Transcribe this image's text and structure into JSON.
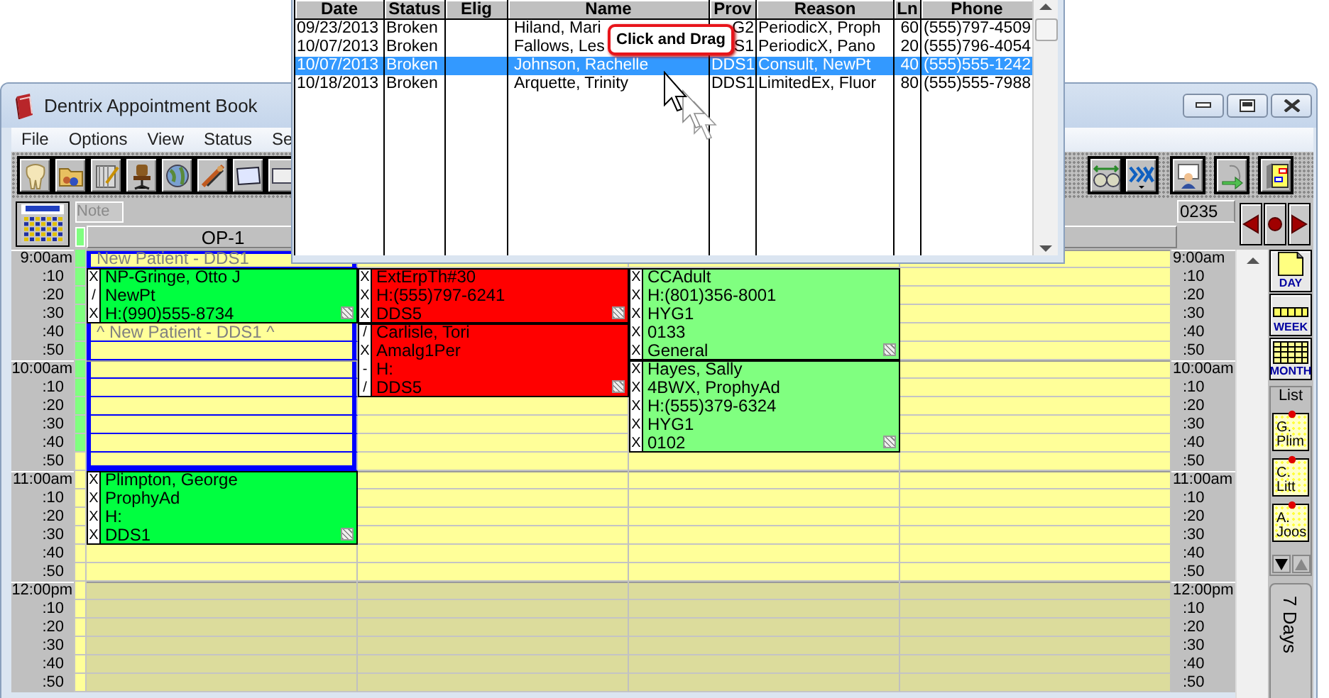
{
  "window": {
    "title": "Dentrix Appointment Book"
  },
  "menu": [
    "File",
    "Options",
    "View",
    "Status",
    "Se"
  ],
  "note": {
    "placeholder": "Note"
  },
  "counter": "0235",
  "slots": [
    {
      "left": "9:00am",
      "right": "9:00am",
      "kind": "hour",
      "shaded": false,
      "marked": true
    },
    {
      "left": ":10",
      "right": ":10",
      "kind": "minute",
      "shaded": false,
      "marked": true
    },
    {
      "left": ":20",
      "right": ":20",
      "kind": "minute",
      "shaded": false,
      "marked": true
    },
    {
      "left": ":30",
      "right": ":30",
      "kind": "minute",
      "shaded": false,
      "marked": true
    },
    {
      "left": ":40",
      "right": ":40",
      "kind": "minute",
      "shaded": false,
      "marked": true
    },
    {
      "left": ":50",
      "right": ":50",
      "kind": "minute",
      "shaded": false,
      "marked": true
    },
    {
      "left": "10:00am",
      "right": "10:00am",
      "kind": "hour",
      "shaded": false,
      "marked": true
    },
    {
      "left": ":10",
      "right": ":10",
      "kind": "minute",
      "shaded": false,
      "marked": true
    },
    {
      "left": ":20",
      "right": ":20",
      "kind": "minute",
      "shaded": false,
      "marked": true
    },
    {
      "left": ":30",
      "right": ":30",
      "kind": "minute",
      "shaded": false,
      "marked": true
    },
    {
      "left": ":40",
      "right": ":40",
      "kind": "minute",
      "shaded": false,
      "marked": true
    },
    {
      "left": ":50",
      "right": ":50",
      "kind": "minute",
      "shaded": false,
      "marked": false
    },
    {
      "left": "11:00am",
      "right": "11:00am",
      "kind": "hour",
      "shaded": false,
      "marked": false
    },
    {
      "left": ":10",
      "right": ":10",
      "kind": "minute",
      "shaded": false,
      "marked": false
    },
    {
      "left": ":20",
      "right": ":20",
      "kind": "minute",
      "shaded": false,
      "marked": false
    },
    {
      "left": ":30",
      "right": ":30",
      "kind": "minute",
      "shaded": false,
      "marked": false
    },
    {
      "left": ":40",
      "right": ":40",
      "kind": "minute",
      "shaded": false,
      "marked": false
    },
    {
      "left": ":50",
      "right": ":50",
      "kind": "minute",
      "shaded": false,
      "marked": false
    },
    {
      "left": "12:00pm",
      "right": "12:00pm",
      "kind": "hour",
      "shaded": true,
      "marked": false
    },
    {
      "left": ":10",
      "right": ":10",
      "kind": "minute",
      "shaded": true,
      "marked": false
    },
    {
      "left": ":20",
      "right": ":20",
      "kind": "minute",
      "shaded": true,
      "marked": false
    },
    {
      "left": ":30",
      "right": ":30",
      "kind": "minute",
      "shaded": true,
      "marked": false
    },
    {
      "left": ":40",
      "right": ":40",
      "kind": "minute",
      "shaded": true,
      "marked": false
    },
    {
      "left": ":50",
      "right": ":50",
      "kind": "minute",
      "shaded": true,
      "marked": false
    }
  ],
  "columns": [
    {
      "header": "OP-1",
      "entries": [
        {
          "kind": "slot",
          "reserved": true,
          "label": "New Patient - DDS1"
        },
        {
          "kind": "appointment",
          "color": "#00ff40",
          "lines": [
            {
              "mark": "X",
              "text": "NP-Gringe, Otto J"
            },
            {
              "mark": "/",
              "text": "NewPt"
            },
            {
              "mark": "X",
              "text": "H:(990)555-8734"
            }
          ]
        },
        {
          "kind": "slot",
          "reserved": true,
          "label": "^ New Patient - DDS1 ^"
        },
        {
          "kind": "slot",
          "reserved": true
        },
        {
          "kind": "slot",
          "reserved": true
        },
        {
          "kind": "slot",
          "reserved": true
        },
        {
          "kind": "slot",
          "reserved": true
        },
        {
          "kind": "slot",
          "reserved": true
        },
        {
          "kind": "slot",
          "reserved": true
        },
        {
          "kind": "slot",
          "reserved": true
        },
        {
          "kind": "appointment",
          "color": "#00ff40",
          "lines": [
            {
              "mark": "X",
              "text": "Plimpton, George"
            },
            {
              "mark": "X",
              "text": "ProphyAd"
            },
            {
              "mark": "X",
              "text": "H:"
            },
            {
              "mark": "X",
              "text": "DDS1"
            }
          ]
        },
        {
          "kind": "slot",
          "reserved": false
        },
        {
          "kind": "slot",
          "reserved": false
        },
        {
          "kind": "slot",
          "reserved": false
        },
        {
          "kind": "slot",
          "reserved": false
        },
        {
          "kind": "slot",
          "reserved": false
        },
        {
          "kind": "slot",
          "reserved": false
        },
        {
          "kind": "slot",
          "reserved": false
        },
        {
          "kind": "slot",
          "reserved": false
        }
      ]
    },
    {
      "entries": [
        {
          "kind": "slot",
          "reserved": false
        },
        {
          "kind": "appointment",
          "color": "#ff0000",
          "lines": [
            {
              "mark": "X",
              "text": "ExtErpTh#30"
            },
            {
              "mark": "X",
              "text": "H:(555)797-6241"
            },
            {
              "mark": "X",
              "text": "DDS5"
            }
          ]
        },
        {
          "kind": "appointment",
          "color": "#ff0000",
          "lines": [
            {
              "mark": "/",
              "text": "Carlisle, Tori"
            },
            {
              "mark": "X",
              "text": "Amalg1Per"
            },
            {
              "mark": "-",
              "text": "H:"
            },
            {
              "mark": "/",
              "text": "DDS5"
            }
          ]
        },
        {
          "kind": "slot",
          "reserved": false
        },
        {
          "kind": "slot",
          "reserved": false
        },
        {
          "kind": "slot",
          "reserved": false
        },
        {
          "kind": "slot",
          "reserved": false
        },
        {
          "kind": "slot",
          "reserved": false
        },
        {
          "kind": "slot",
          "reserved": false
        },
        {
          "kind": "slot",
          "reserved": false
        },
        {
          "kind": "slot",
          "reserved": false
        },
        {
          "kind": "slot",
          "reserved": false
        },
        {
          "kind": "slot",
          "reserved": false
        },
        {
          "kind": "slot",
          "reserved": false
        },
        {
          "kind": "slot",
          "reserved": false
        },
        {
          "kind": "slot",
          "reserved": false
        },
        {
          "kind": "slot",
          "reserved": false
        },
        {
          "kind": "slot",
          "reserved": false
        },
        {
          "kind": "slot",
          "reserved": false
        }
      ]
    },
    {
      "entries": [
        {
          "kind": "slot",
          "reserved": false
        },
        {
          "kind": "appointment",
          "color": "#80ff80",
          "lines": [
            {
              "mark": "X",
              "text": "CCAdult"
            },
            {
              "mark": "X",
              "text": "H:(801)356-8001"
            },
            {
              "mark": "X",
              "text": "HYG1"
            },
            {
              "mark": "X",
              "text": "0133"
            },
            {
              "mark": "X",
              "text": "General"
            }
          ]
        },
        {
          "kind": "appointment",
          "color": "#80ff80",
          "lines": [
            {
              "mark": "X",
              "text": "Hayes, Sally"
            },
            {
              "mark": "X",
              "text": "4BWX, ProphyAd"
            },
            {
              "mark": "X",
              "text": "H:(555)379-6324"
            },
            {
              "mark": "X",
              "text": "HYG1"
            },
            {
              "mark": "X",
              "text": "0102"
            }
          ]
        },
        {
          "kind": "slot",
          "reserved": false
        },
        {
          "kind": "slot",
          "reserved": false
        },
        {
          "kind": "slot",
          "reserved": false
        },
        {
          "kind": "slot",
          "reserved": false
        },
        {
          "kind": "slot",
          "reserved": false
        },
        {
          "kind": "slot",
          "reserved": false
        },
        {
          "kind": "slot",
          "reserved": false
        },
        {
          "kind": "slot",
          "reserved": false
        },
        {
          "kind": "slot",
          "reserved": false
        },
        {
          "kind": "slot",
          "reserved": false
        },
        {
          "kind": "slot",
          "reserved": false
        },
        {
          "kind": "slot",
          "reserved": false
        },
        {
          "kind": "slot",
          "reserved": false
        }
      ]
    },
    {
      "entries": [
        {
          "kind": "slot",
          "reserved": false
        },
        {
          "kind": "slot",
          "reserved": false
        },
        {
          "kind": "slot",
          "reserved": false
        },
        {
          "kind": "slot",
          "reserved": false
        },
        {
          "kind": "slot",
          "reserved": false
        },
        {
          "kind": "slot",
          "reserved": false
        },
        {
          "kind": "slot",
          "reserved": false
        },
        {
          "kind": "slot",
          "reserved": false
        },
        {
          "kind": "slot",
          "reserved": false
        },
        {
          "kind": "slot",
          "reserved": false
        },
        {
          "kind": "slot",
          "reserved": false
        },
        {
          "kind": "slot",
          "reserved": false
        },
        {
          "kind": "slot",
          "reserved": false
        },
        {
          "kind": "slot",
          "reserved": false
        },
        {
          "kind": "slot",
          "reserved": false
        },
        {
          "kind": "slot",
          "reserved": false
        },
        {
          "kind": "slot",
          "reserved": false
        },
        {
          "kind": "slot",
          "reserved": false
        },
        {
          "kind": "slot",
          "reserved": false
        },
        {
          "kind": "slot",
          "reserved": false
        },
        {
          "kind": "slot",
          "reserved": false
        },
        {
          "kind": "slot",
          "reserved": false
        },
        {
          "kind": "slot",
          "reserved": false
        },
        {
          "kind": "slot",
          "reserved": false
        }
      ]
    }
  ],
  "view_buttons": [
    "DAY",
    "WEEK",
    "MONTH"
  ],
  "list_panel": {
    "title": "List",
    "notes": [
      "G. Plim",
      "C. Litt",
      "A. Joos"
    ]
  },
  "side_tab": "7 Days",
  "appointment_list": {
    "columns": [
      "Date",
      "Status",
      "Elig",
      "Name",
      "Prov",
      "Reason",
      "Ln",
      "Phone"
    ],
    "rows": [
      {
        "cells": [
          "09/23/2013",
          "Broken",
          "",
          "Hiland, Mari",
          "G2",
          "PeriodicX, Proph",
          "60",
          "(555)797-4509"
        ],
        "selected": false
      },
      {
        "cells": [
          "10/07/2013",
          "Broken",
          "",
          "Fallows, Les",
          "S1",
          "PeriodicX, Pano",
          "20",
          "(555)796-4054"
        ],
        "selected": false
      },
      {
        "cells": [
          "10/07/2013",
          "Broken",
          "",
          "Johnson, Rachelle",
          "DDS1",
          "Consult, NewPt",
          "40",
          "(555)555-1242"
        ],
        "selected": true
      },
      {
        "cells": [
          "10/18/2013",
          "Broken",
          "",
          "Arquette, Trinity",
          "DDS1",
          "LimitedEx, Fluor",
          "80",
          "(555)555-7988"
        ],
        "selected": false
      }
    ]
  },
  "tooltip": "Click and Drag"
}
